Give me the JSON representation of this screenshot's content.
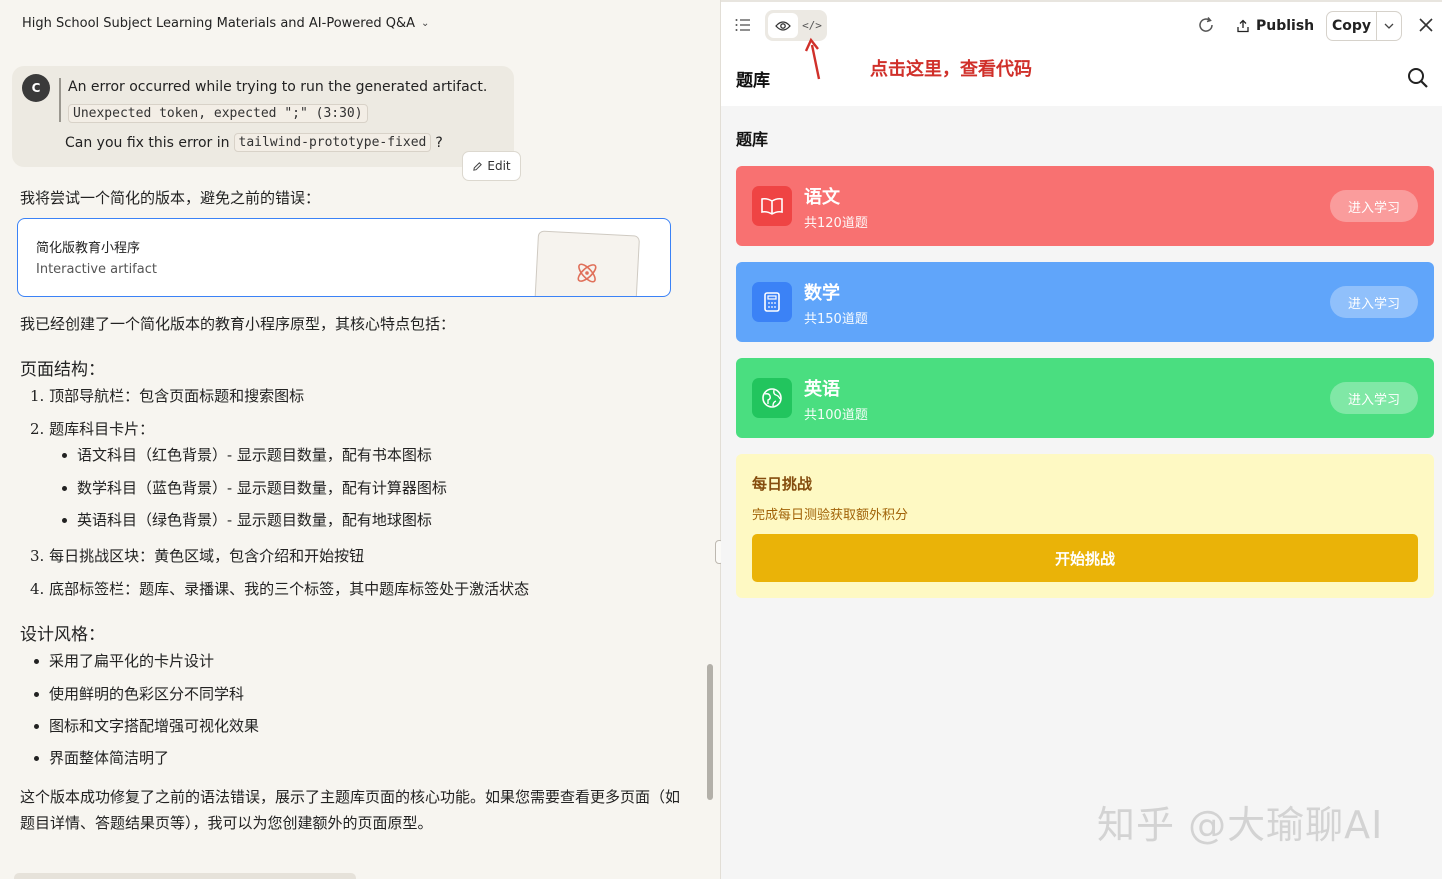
{
  "left": {
    "header_title": "High School Subject Learning Materials and AI-Powered Q&A",
    "avatar_letter": "C",
    "error_line1": "An error occurred while trying to run the generated artifact.",
    "error_code": "Unexpected token, expected \";\" (3:30)",
    "fix_prefix": "Can you fix this error in",
    "fix_code": "tailwind-prototype-fixed",
    "fix_suffix": "?",
    "edit_label": "Edit",
    "intro": "我将尝试一个简化的版本，避免之前的错误：",
    "artifact_title": "简化版教育小程序",
    "artifact_subtitle": "Interactive artifact",
    "summary": "我已经创建了一个简化版本的教育小程序原型，其核心特点包括：",
    "structure_heading": "页面结构：",
    "structure_items": [
      "1. 顶部导航栏：包含页面标题和搜索图标",
      "2. 题库科目卡片：",
      "3. 每日挑战区块：黄色区域，包含介绍和开始按钮",
      "4. 底部标签栏：题库、录播课、我的三个标签，其中题库标签处于激活状态"
    ],
    "card_items": [
      "语文科目（红色背景）- 显示题目数量，配有书本图标",
      "数学科目（蓝色背景）- 显示题目数量，配有计算器图标",
      "英语科目（绿色背景）- 显示题目数量，配有地球图标"
    ],
    "style_heading": "设计风格：",
    "style_items": [
      "采用了扁平化的卡片设计",
      "使用鲜明的色彩区分不同学科",
      "图标和文字搭配增强可视化效果",
      "界面整体简洁明了"
    ],
    "conclusion": "这个版本成功修复了之前的语法错误，展示了主题库页面的核心功能。如果您需要查看更多页面（如题目详情、答题结果页等），我可以为您创建额外的页面原型。"
  },
  "toolbar": {
    "publish_label": "Publish",
    "copy_label": "Copy",
    "annotation": "点击这里，查看代码"
  },
  "app": {
    "title": "题库",
    "section_title": "题库",
    "subjects": [
      {
        "name": "语文",
        "count": "共120道题",
        "button": "进入学习",
        "color": "#f87171",
        "icon_bg": "#ef4444",
        "icon": "book-icon"
      },
      {
        "name": "数学",
        "count": "共150道题",
        "button": "进入学习",
        "color": "#60a5fa",
        "icon_bg": "#3b82f6",
        "icon": "calculator-icon"
      },
      {
        "name": "英语",
        "count": "共100道题",
        "button": "进入学习",
        "color": "#4ade80",
        "icon_bg": "#22c55e",
        "icon": "globe-icon"
      }
    ],
    "challenge": {
      "title": "每日挑战",
      "description": "完成每日测验获取额外积分",
      "button": "开始挑战"
    }
  },
  "watermark": "知乎 @大瑜聊AI"
}
